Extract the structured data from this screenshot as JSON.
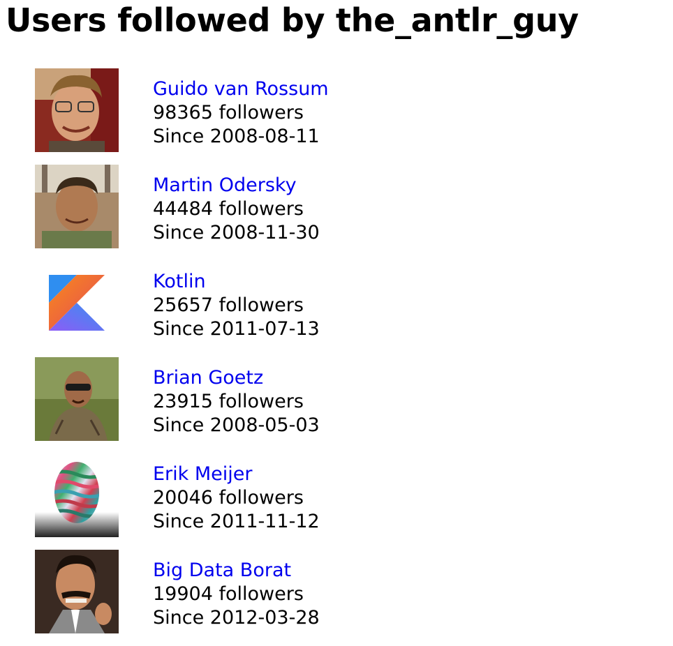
{
  "page": {
    "title": "Users followed by the_antlr_guy"
  },
  "users": [
    {
      "name": "Guido van Rossum",
      "followers": "98365 followers",
      "since": "Since 2008-08-11",
      "avatar": "photo-man-glasses"
    },
    {
      "name": "Martin Odersky",
      "followers": "44484 followers",
      "since": "Since 2008-11-30",
      "avatar": "photo-man-outdoors"
    },
    {
      "name": "Kotlin",
      "followers": "25657 followers",
      "since": "Since 2011-07-13",
      "avatar": "kotlin-logo"
    },
    {
      "name": "Brian Goetz",
      "followers": "23915 followers",
      "since": "Since 2008-05-03",
      "avatar": "photo-man-sunglasses"
    },
    {
      "name": "Erik Meijer",
      "followers": "20046 followers",
      "since": "Since 2011-11-12",
      "avatar": "tie-dye-egg"
    },
    {
      "name": "Big Data Borat",
      "followers": "19904 followers",
      "since": "Since 2012-03-28",
      "avatar": "photo-man-mustache"
    }
  ],
  "colors": {
    "link": "#0000ee",
    "text": "#000000",
    "background": "#ffffff"
  }
}
